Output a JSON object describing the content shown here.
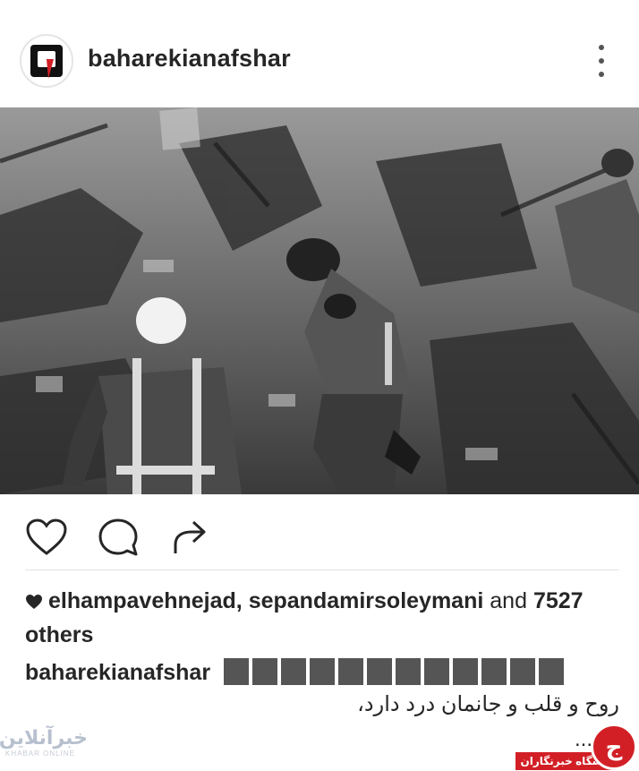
{
  "header": {
    "username": "baharekianafshar",
    "more_icon": "more-vertical-icon"
  },
  "post": {
    "image_icon": "rubble-photo",
    "actions": {
      "like_icon": "heart-icon",
      "comment_icon": "comment-icon",
      "share_icon": "share-icon"
    },
    "likes": {
      "names": "elhampavehnejad, sepandamirsoleymani",
      "and": "and",
      "count": "7527",
      "others": "others"
    },
    "caption": {
      "user": "baharekianafshar",
      "line_rtl": "روح و قلب و جانمان درد دارد،",
      "line_end": "..."
    }
  },
  "watermarks": {
    "left": "خبرآنلاین",
    "left_sub": "KHABAR ONLINE",
    "right_badge": "باشگاه خبرنگاران",
    "right_mark": "ج"
  },
  "colors": {
    "text": "#262626",
    "badge_red": "#d21f26"
  }
}
